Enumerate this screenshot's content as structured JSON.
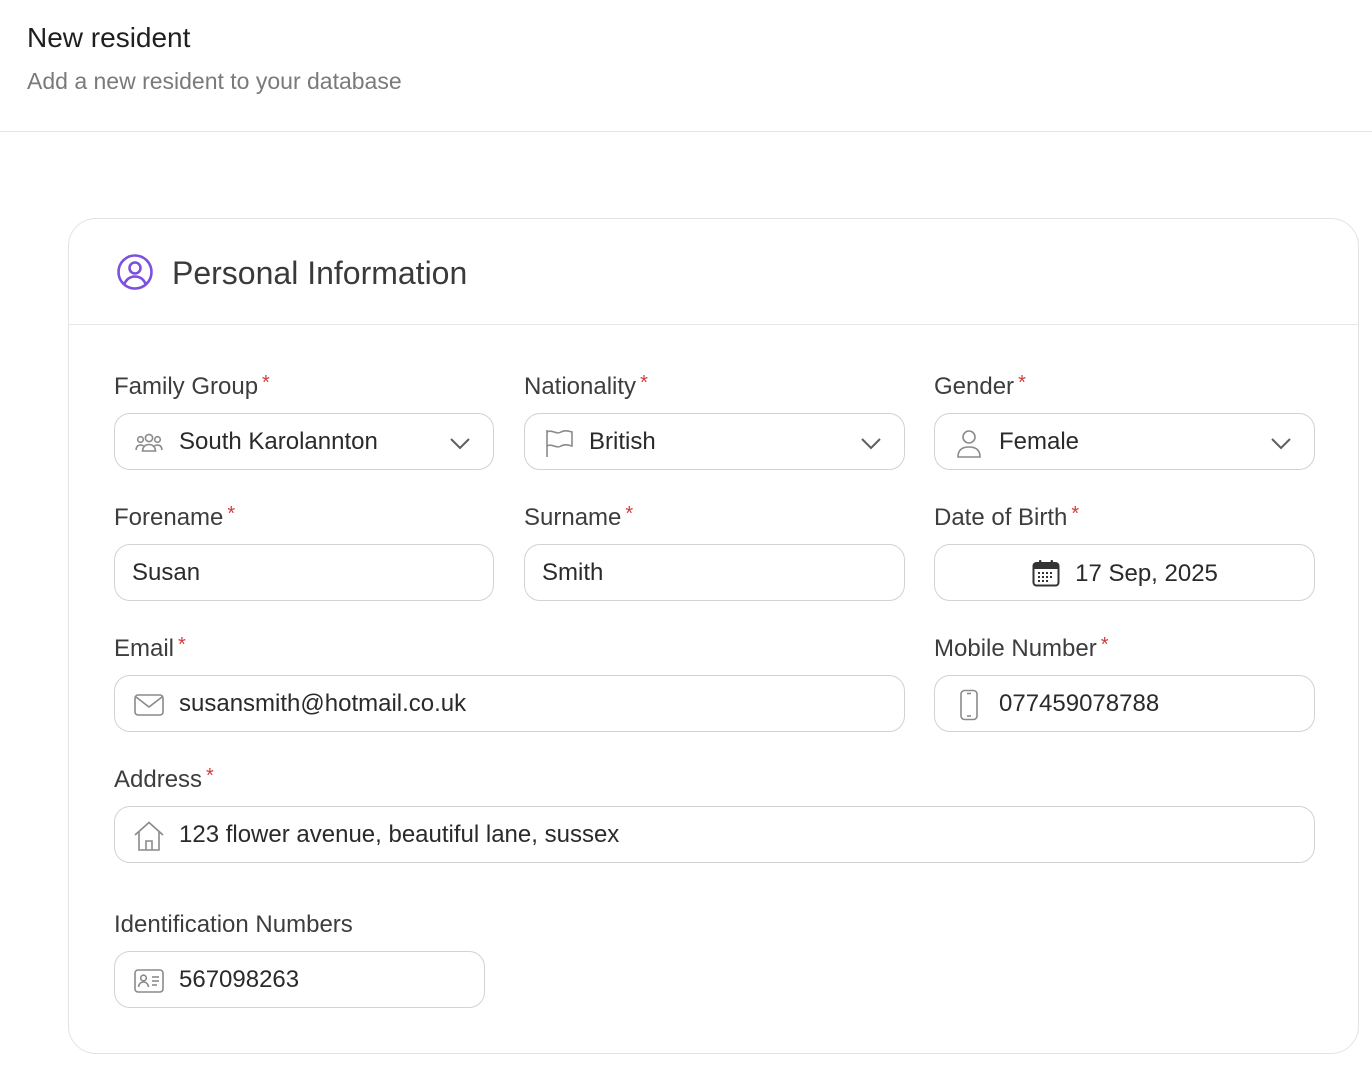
{
  "header": {
    "title": "New resident",
    "subtitle": "Add a new resident to your database"
  },
  "section": {
    "title": "Personal Information",
    "icon": "user-circle-icon",
    "accent_color": "#7c4fe0"
  },
  "required_marker": "*",
  "required_color": "#d33b3b",
  "fields": {
    "family_group": {
      "label": "Family Group",
      "value": "South Karolannton",
      "icon": "users-group-icon"
    },
    "nationality": {
      "label": "Nationality",
      "value": "British",
      "icon": "flag-icon"
    },
    "gender": {
      "label": "Gender",
      "value": "Female",
      "icon": "person-icon"
    },
    "forename": {
      "label": "Forename",
      "value": "Susan"
    },
    "surname": {
      "label": "Surname",
      "value": "Smith"
    },
    "date_of_birth": {
      "label": "Date of Birth",
      "value": "17 Sep, 2025",
      "icon": "calendar-icon"
    },
    "email": {
      "label": "Email",
      "value": "susansmith@hotmail.co.uk",
      "icon": "mail-icon"
    },
    "mobile": {
      "label": "Mobile Number",
      "value": "077459078788",
      "icon": "phone-icon"
    },
    "address": {
      "label": "Address",
      "value": "123 flower avenue, beautiful lane, sussex",
      "icon": "home-icon"
    },
    "identification": {
      "label": "Identification Numbers",
      "value": "567098263",
      "icon": "id-card-icon"
    }
  }
}
